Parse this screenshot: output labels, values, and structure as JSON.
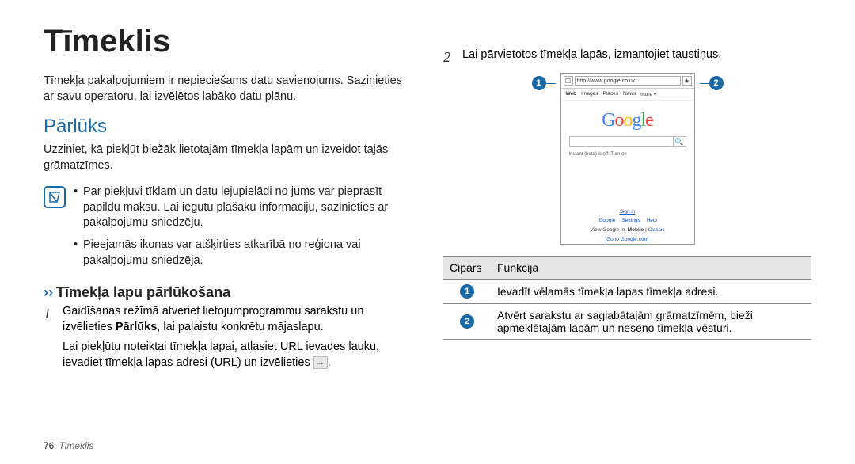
{
  "left": {
    "title": "Tīmeklis",
    "intro": "Tīmekļa pakalpojumiem ir nepieciešams datu savienojums. Sazinieties ar savu operatoru, lai izvēlētos labāko datu plānu.",
    "section": "Pārlūks",
    "section_text": "Uzziniet, kā piekļūt biežāk lietotajām tīmekļa lapām un izveidot tajās grāmatzīmes.",
    "note1": "Par piekļuvi tīklam un datu lejupielādi no jums var pieprasīt papildu maksu. Lai iegūtu plašāku informāciju, sazinieties ar pakalpojumu sniedzēju.",
    "note2": "Pieejamās ikonas var atšķirties atkarībā no reģiona vai pakalpojumu sniedzēja.",
    "sub": "Tīmekļa lapu pārlūkošana",
    "step1_num": "1",
    "step1a": "Gaidīšanas režīmā atveriet lietojumprogrammu sarakstu un izvēlieties ",
    "step1_bold": "Pārlūks",
    "step1b": ", lai palaistu konkrētu mājaslapu.",
    "step1c": "Lai piekļūtu noteiktai tīmekļa lapai, atlasiet URL ievades lauku, ievadiet tīmekļa lapas adresi (URL) un izvēlieties ",
    "footer_page": "76",
    "footer_chapter": "Tīmeklis"
  },
  "right": {
    "step2_num": "2",
    "step2_text": "Lai pārvietotos tīmekļa lapās, izmantojiet taustiņus.",
    "marker1": "1",
    "marker2": "2",
    "phone": {
      "url": "http://www.google.co.uk/",
      "tabs": {
        "web": "Web",
        "images": "Images",
        "places": "Places",
        "news": "News",
        "more": "more ▾"
      },
      "logo": {
        "g1": "G",
        "o1": "o",
        "o2": "o",
        "g2": "g",
        "l": "l",
        "e": "e"
      },
      "instant": "Instant (beta) is off: Turn on",
      "signin": "Sign in",
      "links": {
        "ig": "iGoogle",
        "settings": "Settings",
        "help": "Help"
      },
      "view": {
        "pre": "View Google in: ",
        "mobile": "Mobile",
        "sep": " | ",
        "classic": "Classic"
      },
      "goto": "Go to Google.com"
    },
    "table": {
      "h1": "Cipars",
      "h2": "Funkcija",
      "r1_num": "1",
      "r1_text": "Ievadīt vēlamās tīmekļa lapas tīmekļa adresi.",
      "r2_num": "2",
      "r2_text": "Atvērt sarakstu ar saglabātajām grāmatzīmēm, bieži apmeklētajām lapām un neseno tīmekļa vēsturi."
    }
  }
}
